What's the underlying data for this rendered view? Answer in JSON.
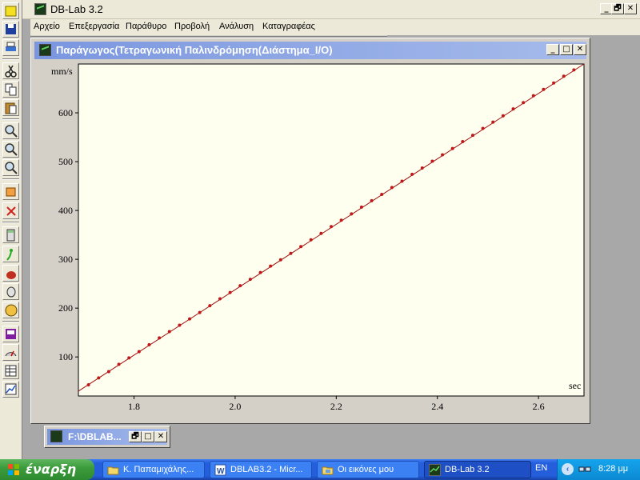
{
  "app": {
    "title": "DB-Lab 3.2",
    "controls": {
      "minimize": "_",
      "restore": "🗗",
      "close": "✕"
    }
  },
  "menu": [
    "Αρχείο",
    "Επεξεργασία",
    "Παράθυρο",
    "Προβολή",
    "Ανάλυση",
    "Καταγραφέας"
  ],
  "toolbar_icons": [
    "new-icon",
    "save-icon",
    "print-icon",
    "cut-icon",
    "copy-icon",
    "paste-icon",
    "zoom-in-icon",
    "zoom-out-icon",
    "zoom-fit-icon",
    "add-marker-icon",
    "delete-marker-icon",
    "calculator-icon",
    "run-icon",
    "sensor-icon",
    "probe-icon",
    "hand-icon",
    "data-icon",
    "gauge-icon",
    "table-icon",
    "graph-icon"
  ],
  "graph_window": {
    "title": "Παράγωγος(Τετραγωνική Παλινδρόμηση(Διάστημα_I/O)",
    "controls": {
      "minimize": "_",
      "maximize": "□",
      "close": "✕"
    }
  },
  "chart_data": {
    "type": "scatter",
    "xlabel": "sec",
    "ylabel": "mm/s",
    "xlim": [
      1.69,
      2.69
    ],
    "ylim": [
      20,
      700
    ],
    "x_ticks": [
      "1.8",
      "2.0",
      "2.2",
      "2.4",
      "2.6"
    ],
    "x_tick_values": [
      1.8,
      2.0,
      2.2,
      2.4,
      2.6
    ],
    "y_ticks": [
      "100",
      "200",
      "300",
      "400",
      "500",
      "600"
    ],
    "y_tick_values": [
      100,
      200,
      300,
      400,
      500,
      600
    ],
    "fit_line": {
      "x": [
        1.69,
        2.69
      ],
      "y": [
        30,
        700
      ]
    },
    "series": [
      {
        "marker_color": "#c01818",
        "line_color": "#a01010",
        "x": [
          1.71,
          1.73,
          1.75,
          1.77,
          1.79,
          1.81,
          1.83,
          1.85,
          1.87,
          1.89,
          1.91,
          1.93,
          1.95,
          1.97,
          1.99,
          2.01,
          2.03,
          2.05,
          2.07,
          2.09,
          2.11,
          2.13,
          2.15,
          2.17,
          2.19,
          2.21,
          2.23,
          2.25,
          2.27,
          2.29,
          2.31,
          2.33,
          2.35,
          2.37,
          2.39,
          2.41,
          2.43,
          2.45,
          2.47,
          2.49,
          2.51,
          2.53,
          2.55,
          2.57,
          2.59,
          2.61,
          2.63,
          2.65,
          2.67
        ],
        "y": [
          43,
          57,
          70,
          85,
          98,
          111,
          125,
          139,
          152,
          165,
          178,
          191,
          205,
          219,
          232,
          246,
          259,
          273,
          286,
          299,
          312,
          326,
          340,
          353,
          367,
          380,
          393,
          407,
          420,
          433,
          447,
          460,
          474,
          487,
          501,
          514,
          527,
          541,
          554,
          568,
          581,
          594,
          608,
          621,
          635,
          648,
          661,
          675,
          688
        ]
      }
    ]
  },
  "minimized_window": {
    "title": "F:\\DBLAB...",
    "controls": {
      "restore": "🗗",
      "maximize": "□",
      "close": "✕"
    }
  },
  "taskbar": {
    "start_label": "έναρξη",
    "buttons": [
      {
        "label": "Κ. Παπαμιχάλης...",
        "icon": "folder-icon",
        "active": false
      },
      {
        "label": "DBLAB3.2 - Micr...",
        "icon": "word-icon",
        "active": false
      },
      {
        "label": "Οι εικόνες μου",
        "icon": "pictures-folder-icon",
        "active": false
      },
      {
        "label": "DB-Lab 3.2",
        "icon": "dblab-icon",
        "active": true
      }
    ],
    "language": "EN",
    "clock": "8:28 μμ"
  }
}
